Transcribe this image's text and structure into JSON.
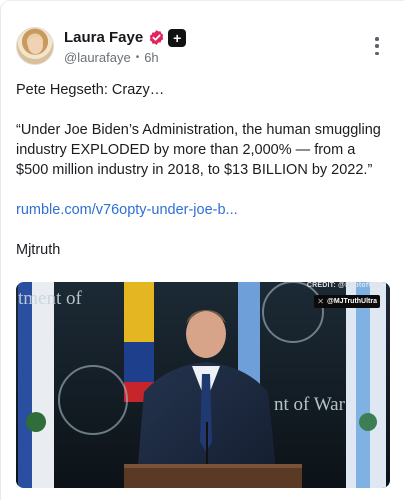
{
  "author": {
    "name": "Laura Faye",
    "handle": "@laurafaye",
    "time": "6h",
    "verified_color": "#e0245e"
  },
  "post": {
    "line1": "Pete Hegseth: Crazy…",
    "quote": "“Under Joe Biden’s Administration, the human smuggling industry EXPLODED by more than 2,000% — from a $500 million industry in 2018, to $13 BILLION by 2022.”",
    "link": "rumble.com/v76opty-under-joe-b...",
    "tag": "Mjtruth"
  },
  "video": {
    "credit": "CREDIT: @DeptofWar",
    "watermark_x": "✕",
    "watermark_handle": "@MJTruthUltra",
    "wall_left": "tment of",
    "wall_right": "nt of War"
  }
}
